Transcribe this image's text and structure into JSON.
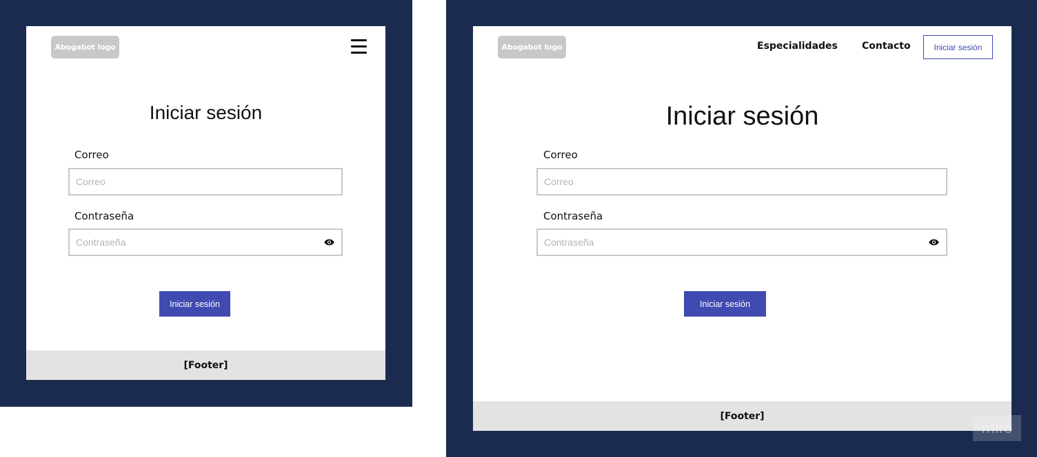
{
  "logo_text": "Abogabot logo",
  "nav": {
    "links": [
      "Especialidades",
      "Contacto"
    ],
    "login_label": "Iniciar sesión"
  },
  "login": {
    "title": "Iniciar sesión",
    "email_label": "Correo",
    "email_placeholder": "Correo",
    "password_label": "Contraseña",
    "password_placeholder": "Contraseña",
    "submit_label": "Iniciar sesión"
  },
  "footer_text": "[Footer]",
  "watermark_text": "miro",
  "colors": {
    "frame_background": "#1a2b4f",
    "accent": "#3f4bb0",
    "logo_background": "#c8c8c8",
    "footer_background": "#e3e3e3"
  },
  "icons": {
    "menu": "hamburger-menu-icon",
    "password_toggle": "eye-icon"
  }
}
